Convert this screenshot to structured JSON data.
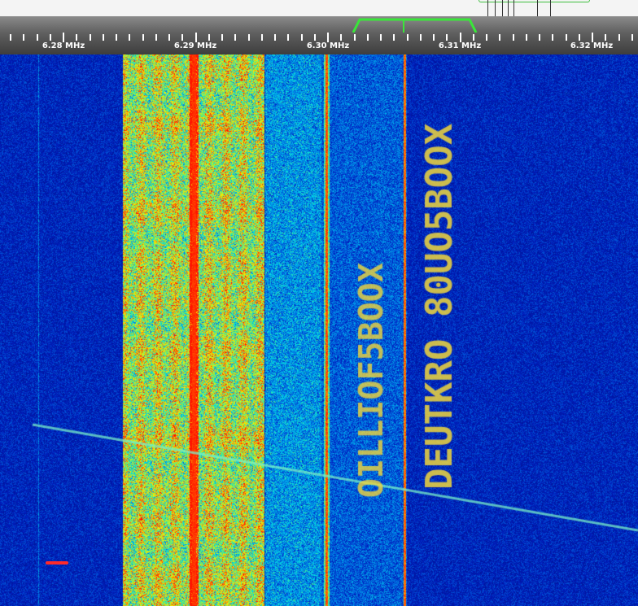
{
  "scale": {
    "labels": [
      "6.28 MHz",
      "6.29 MHz",
      "6.30 MHz",
      "6.31 MHz",
      "6.32 MHz"
    ]
  },
  "colors": {
    "background": "#00077a",
    "filter": "#39e739",
    "carrier": "#ff2200",
    "marker": "#ff2a2a"
  },
  "waterfall": {
    "text_line_1": "OILLIOF5BOOX",
    "text_line_2": "DEUTKRO 80UO5BOOX"
  }
}
